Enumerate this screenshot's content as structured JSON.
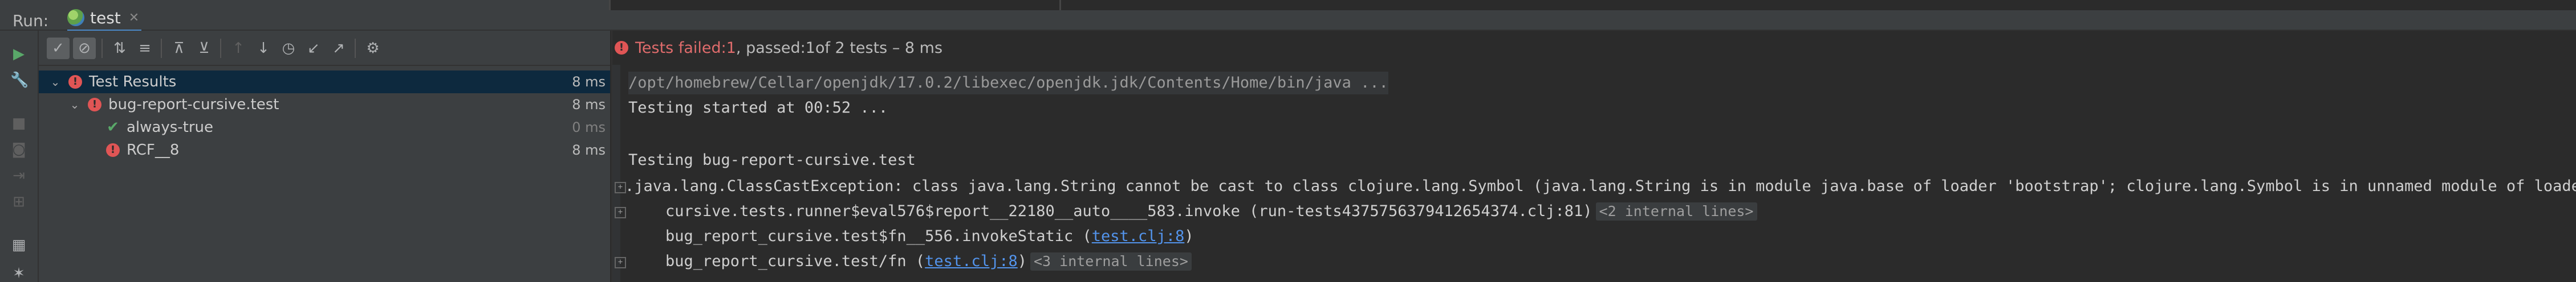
{
  "run": {
    "label": "Run:",
    "tab_name": "test",
    "tab_icon": "clojure-icon"
  },
  "tree": {
    "rows": [
      {
        "label": "Test Results",
        "duration": "8 ms",
        "status": "failed",
        "expanded": true
      },
      {
        "label": "bug-report-cursive.test",
        "duration": "8 ms",
        "status": "failed",
        "expanded": true
      },
      {
        "label": "always-true",
        "duration": "0 ms",
        "status": "passed"
      },
      {
        "label": "RCF__8",
        "duration": "8 ms",
        "status": "failed"
      }
    ]
  },
  "status": {
    "failed_prefix": "Tests failed: ",
    "failed_count": "1",
    "passed_prefix": ", passed: ",
    "passed_count": "1",
    "suffix": " of 2 tests – 8 ms"
  },
  "console": {
    "line1": "/opt/homebrew/Cellar/openjdk/17.0.2/libexec/openjdk.jdk/Contents/Home/bin/java ...",
    "line2": "Testing started at 00:52 ...",
    "line4": "Testing bug-report-cursive.test",
    "line5": ".java.lang.ClassCastException: class java.lang.String cannot be cast to class clojure.lang.Symbol (java.lang.String is in module java.base of loader 'bootstrap'; clojure.lang.Symbol is in unnamed module of loader 'app')",
    "line6_text": "    cursive.tests.runner$eval576$report__22180__auto____583.invoke (run-tests4375756379412654374.clj:81)",
    "line6_internal": "<2 internal lines>",
    "line7_prefix": "    bug_report_cursive.test$fn__556.invokeStatic (",
    "line7_link": "test.clj:8",
    "line7_suffix": ")",
    "line8_prefix": "    bug_report_cursive.test/fn (",
    "line8_link": "test.clj:8",
    "line8_suffix": ")",
    "line8_internal": "<3 internal lines>"
  },
  "colors": {
    "accent": "#4a88c7",
    "error": "#e05555",
    "success": "#59a869",
    "link": "#5394ec"
  }
}
